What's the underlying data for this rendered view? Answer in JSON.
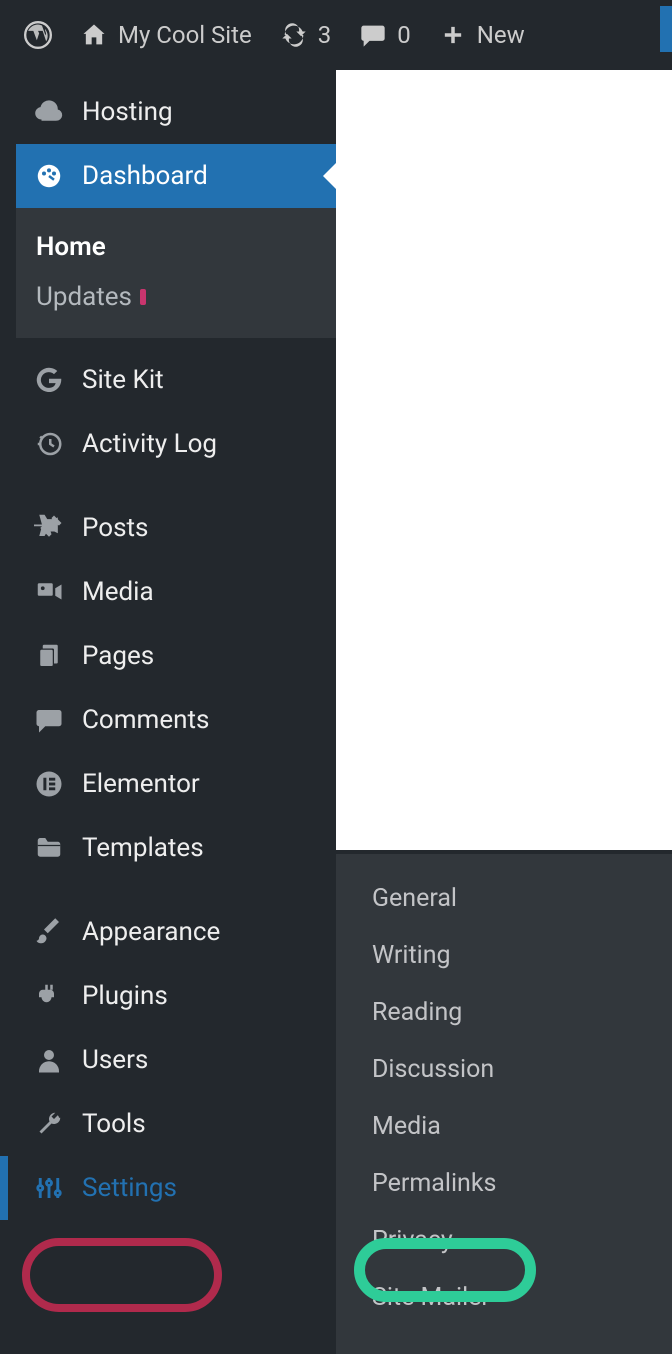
{
  "adminbar": {
    "site_name": "My Cool Site",
    "updates_count": "3",
    "comments_count": "0",
    "new_label": "New"
  },
  "sidebar": {
    "hosting": "Hosting",
    "dashboard": "Dashboard",
    "dashboard_sub": {
      "home": "Home",
      "updates": "Updates"
    },
    "site_kit": "Site Kit",
    "activity_log": "Activity Log",
    "posts": "Posts",
    "media": "Media",
    "pages": "Pages",
    "comments": "Comments",
    "elementor": "Elementor",
    "templates": "Templates",
    "appearance": "Appearance",
    "plugins": "Plugins",
    "users": "Users",
    "tools": "Tools",
    "settings": "Settings"
  },
  "settings_flyout": {
    "general": "General",
    "writing": "Writing",
    "reading": "Reading",
    "discussion": "Discussion",
    "media": "Media",
    "permalinks": "Permalinks",
    "privacy": "Privacy",
    "site_mailer": "Site Mailer"
  }
}
